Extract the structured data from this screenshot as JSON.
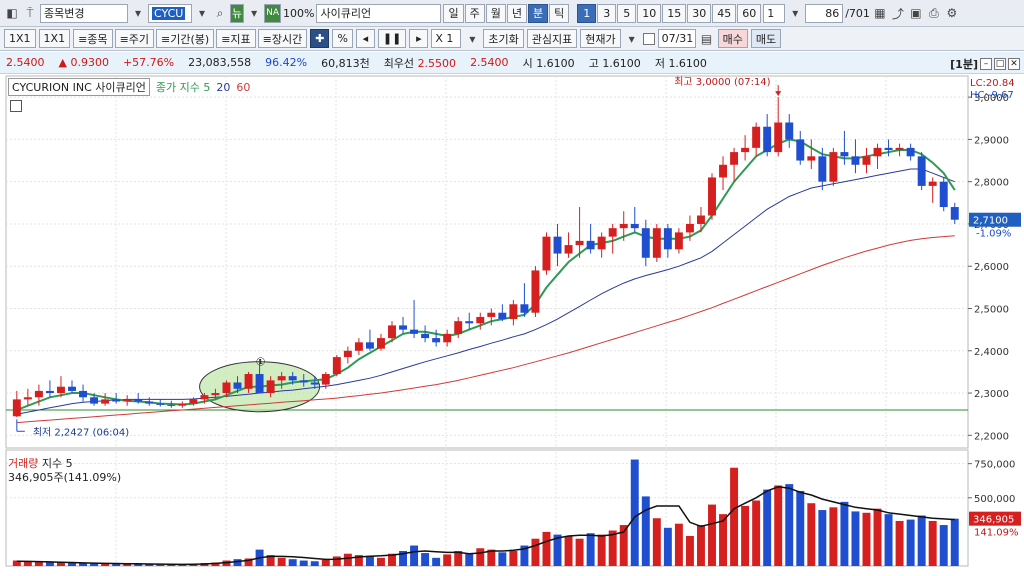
{
  "toolbar": {
    "change_stock": "종목변경",
    "code": "CYCU",
    "new_badge": "뉴",
    "na_badge": "NA",
    "zoom": "100%",
    "stock_name": "사이큐리언",
    "periods": [
      "일",
      "주",
      "월",
      "년",
      "분",
      "틱"
    ],
    "active_period": "분",
    "intervals": [
      "1",
      "3",
      "5",
      "10",
      "15",
      "30",
      "45",
      "60"
    ],
    "interval_value": "1",
    "count": "86",
    "total": "/701"
  },
  "toolbar2": {
    "layout1": "1X1",
    "layout2": "1X1",
    "items": [
      "≡종목",
      "≡주기",
      "≡기간(봉)",
      "≡지표",
      "≡장시간"
    ],
    "multiplier": "X 1",
    "reset": "초기화",
    "indicators": "관심지표",
    "price_type": "현재가",
    "date": "07/31",
    "buy": "매수",
    "sell": "매도"
  },
  "quote": {
    "price": "2.5400",
    "change": "0.9300",
    "change_pct": "+57.76%",
    "volume": "23,083,558",
    "vol_ratio": "96.42%",
    "amount": "60,813천",
    "best_ask_label": "최우선",
    "best_ask": "2.5500",
    "best_bid": "2.5400",
    "open_label": "시",
    "open": "1.6100",
    "high_label": "고",
    "high": "1.6100",
    "low_label": "저",
    "low": "1.6100",
    "frame": "[1분]"
  },
  "legend": {
    "name": "CYCURION INC",
    "name_kr": "사이큐리언",
    "ma_label": "종가 지수 5",
    "ma20": "20",
    "ma60": "60"
  },
  "colors": {
    "up": "#d62020",
    "down": "#1f4fd0",
    "ma5": "#2e9a52",
    "ma20": "#2a3a9a",
    "ma60": "#d03a3a",
    "vol_ma": "#111111",
    "ref_line": "#2e8b2e",
    "price_tag": "#1f5fbf"
  },
  "chart_data": {
    "type": "candlestick",
    "y_ticks": [
      "3,0000",
      "2,9000",
      "2,8000",
      "2,7000",
      "2,6000",
      "2,5000",
      "2,4000",
      "2,3000",
      "2,2000"
    ],
    "ylim": [
      2.17,
      3.05
    ],
    "lc_label": "LC:20.84",
    "hc_label": "HC:-9.67",
    "current_price_label": "2,7100",
    "current_change_label": "-1.09%",
    "high_annotation": "최고 3,0000 (07:14)",
    "low_annotation": "최저 2,2427 (06:04)",
    "circle_marker": "①",
    "candles": [
      {
        "o": 2.245,
        "h": 2.305,
        "l": 2.243,
        "c": 2.285
      },
      {
        "o": 2.285,
        "h": 2.31,
        "l": 2.27,
        "c": 2.29
      },
      {
        "o": 2.29,
        "h": 2.32,
        "l": 2.27,
        "c": 2.305
      },
      {
        "o": 2.305,
        "h": 2.33,
        "l": 2.29,
        "c": 2.3
      },
      {
        "o": 2.3,
        "h": 2.34,
        "l": 2.29,
        "c": 2.315
      },
      {
        "o": 2.315,
        "h": 2.33,
        "l": 2.3,
        "c": 2.305
      },
      {
        "o": 2.305,
        "h": 2.32,
        "l": 2.28,
        "c": 2.29
      },
      {
        "o": 2.29,
        "h": 2.3,
        "l": 2.27,
        "c": 2.275
      },
      {
        "o": 2.275,
        "h": 2.3,
        "l": 2.27,
        "c": 2.285
      },
      {
        "o": 2.285,
        "h": 2.3,
        "l": 2.275,
        "c": 2.28
      },
      {
        "o": 2.28,
        "h": 2.295,
        "l": 2.27,
        "c": 2.285
      },
      {
        "o": 2.285,
        "h": 2.3,
        "l": 2.275,
        "c": 2.28
      },
      {
        "o": 2.28,
        "h": 2.29,
        "l": 2.27,
        "c": 2.275
      },
      {
        "o": 2.275,
        "h": 2.285,
        "l": 2.268,
        "c": 2.272
      },
      {
        "o": 2.272,
        "h": 2.282,
        "l": 2.265,
        "c": 2.27
      },
      {
        "o": 2.27,
        "h": 2.28,
        "l": 2.265,
        "c": 2.275
      },
      {
        "o": 2.275,
        "h": 2.29,
        "l": 2.27,
        "c": 2.285
      },
      {
        "o": 2.285,
        "h": 2.3,
        "l": 2.275,
        "c": 2.295
      },
      {
        "o": 2.295,
        "h": 2.31,
        "l": 2.285,
        "c": 2.3
      },
      {
        "o": 2.3,
        "h": 2.33,
        "l": 2.29,
        "c": 2.325
      },
      {
        "o": 2.325,
        "h": 2.34,
        "l": 2.3,
        "c": 2.31
      },
      {
        "o": 2.31,
        "h": 2.35,
        "l": 2.3,
        "c": 2.345
      },
      {
        "o": 2.345,
        "h": 2.38,
        "l": 2.3,
        "c": 2.3
      },
      {
        "o": 2.3,
        "h": 2.34,
        "l": 2.29,
        "c": 2.33
      },
      {
        "o": 2.33,
        "h": 2.35,
        "l": 2.31,
        "c": 2.34
      },
      {
        "o": 2.34,
        "h": 2.35,
        "l": 2.32,
        "c": 2.33
      },
      {
        "o": 2.33,
        "h": 2.345,
        "l": 2.315,
        "c": 2.325
      },
      {
        "o": 2.325,
        "h": 2.34,
        "l": 2.31,
        "c": 2.32
      },
      {
        "o": 2.32,
        "h": 2.35,
        "l": 2.31,
        "c": 2.345
      },
      {
        "o": 2.345,
        "h": 2.39,
        "l": 2.34,
        "c": 2.385
      },
      {
        "o": 2.385,
        "h": 2.41,
        "l": 2.37,
        "c": 2.4
      },
      {
        "o": 2.4,
        "h": 2.43,
        "l": 2.39,
        "c": 2.42
      },
      {
        "o": 2.42,
        "h": 2.45,
        "l": 2.4,
        "c": 2.405
      },
      {
        "o": 2.405,
        "h": 2.44,
        "l": 2.4,
        "c": 2.43
      },
      {
        "o": 2.43,
        "h": 2.47,
        "l": 2.42,
        "c": 2.46
      },
      {
        "o": 2.46,
        "h": 2.48,
        "l": 2.44,
        "c": 2.45
      },
      {
        "o": 2.45,
        "h": 2.52,
        "l": 2.43,
        "c": 2.44
      },
      {
        "o": 2.44,
        "h": 2.46,
        "l": 2.42,
        "c": 2.43
      },
      {
        "o": 2.43,
        "h": 2.45,
        "l": 2.41,
        "c": 2.42
      },
      {
        "o": 2.42,
        "h": 2.45,
        "l": 2.41,
        "c": 2.44
      },
      {
        "o": 2.44,
        "h": 2.48,
        "l": 2.43,
        "c": 2.47
      },
      {
        "o": 2.47,
        "h": 2.49,
        "l": 2.45,
        "c": 2.465
      },
      {
        "o": 2.465,
        "h": 2.49,
        "l": 2.45,
        "c": 2.48
      },
      {
        "o": 2.48,
        "h": 2.5,
        "l": 2.46,
        "c": 2.49
      },
      {
        "o": 2.49,
        "h": 2.51,
        "l": 2.47,
        "c": 2.475
      },
      {
        "o": 2.475,
        "h": 2.52,
        "l": 2.46,
        "c": 2.51
      },
      {
        "o": 2.51,
        "h": 2.56,
        "l": 2.48,
        "c": 2.49
      },
      {
        "o": 2.49,
        "h": 2.6,
        "l": 2.48,
        "c": 2.59
      },
      {
        "o": 2.59,
        "h": 2.68,
        "l": 2.58,
        "c": 2.67
      },
      {
        "o": 2.67,
        "h": 2.7,
        "l": 2.6,
        "c": 2.63
      },
      {
        "o": 2.63,
        "h": 2.68,
        "l": 2.62,
        "c": 2.65
      },
      {
        "o": 2.65,
        "h": 2.74,
        "l": 2.62,
        "c": 2.66
      },
      {
        "o": 2.66,
        "h": 2.7,
        "l": 2.63,
        "c": 2.64
      },
      {
        "o": 2.64,
        "h": 2.68,
        "l": 2.62,
        "c": 2.67
      },
      {
        "o": 2.67,
        "h": 2.7,
        "l": 2.63,
        "c": 2.69
      },
      {
        "o": 2.69,
        "h": 2.73,
        "l": 2.66,
        "c": 2.7
      },
      {
        "o": 2.7,
        "h": 2.74,
        "l": 2.68,
        "c": 2.69
      },
      {
        "o": 2.69,
        "h": 2.71,
        "l": 2.6,
        "c": 2.62
      },
      {
        "o": 2.62,
        "h": 2.7,
        "l": 2.61,
        "c": 2.69
      },
      {
        "o": 2.69,
        "h": 2.7,
        "l": 2.62,
        "c": 2.64
      },
      {
        "o": 2.64,
        "h": 2.69,
        "l": 2.63,
        "c": 2.68
      },
      {
        "o": 2.68,
        "h": 2.72,
        "l": 2.66,
        "c": 2.7
      },
      {
        "o": 2.7,
        "h": 2.74,
        "l": 2.68,
        "c": 2.72
      },
      {
        "o": 2.72,
        "h": 2.82,
        "l": 2.71,
        "c": 2.81
      },
      {
        "o": 2.81,
        "h": 2.86,
        "l": 2.78,
        "c": 2.84
      },
      {
        "o": 2.84,
        "h": 2.88,
        "l": 2.8,
        "c": 2.87
      },
      {
        "o": 2.87,
        "h": 2.91,
        "l": 2.85,
        "c": 2.88
      },
      {
        "o": 2.88,
        "h": 2.94,
        "l": 2.86,
        "c": 2.93
      },
      {
        "o": 2.93,
        "h": 2.96,
        "l": 2.86,
        "c": 2.87
      },
      {
        "o": 2.87,
        "h": 3.0,
        "l": 2.86,
        "c": 2.94
      },
      {
        "o": 2.94,
        "h": 2.96,
        "l": 2.88,
        "c": 2.9
      },
      {
        "o": 2.9,
        "h": 2.92,
        "l": 2.84,
        "c": 2.85
      },
      {
        "o": 2.85,
        "h": 2.9,
        "l": 2.83,
        "c": 2.86
      },
      {
        "o": 2.86,
        "h": 2.88,
        "l": 2.78,
        "c": 2.8
      },
      {
        "o": 2.8,
        "h": 2.88,
        "l": 2.79,
        "c": 2.87
      },
      {
        "o": 2.87,
        "h": 2.92,
        "l": 2.84,
        "c": 2.86
      },
      {
        "o": 2.86,
        "h": 2.9,
        "l": 2.82,
        "c": 2.84
      },
      {
        "o": 2.84,
        "h": 2.88,
        "l": 2.82,
        "c": 2.86
      },
      {
        "o": 2.86,
        "h": 2.89,
        "l": 2.83,
        "c": 2.88
      },
      {
        "o": 2.88,
        "h": 2.9,
        "l": 2.86,
        "c": 2.875
      },
      {
        "o": 2.875,
        "h": 2.89,
        "l": 2.86,
        "c": 2.88
      },
      {
        "o": 2.88,
        "h": 2.89,
        "l": 2.85,
        "c": 2.86
      },
      {
        "o": 2.86,
        "h": 2.87,
        "l": 2.78,
        "c": 2.79
      },
      {
        "o": 2.79,
        "h": 2.81,
        "l": 2.75,
        "c": 2.8
      },
      {
        "o": 2.8,
        "h": 2.81,
        "l": 2.73,
        "c": 2.74
      },
      {
        "o": 2.74,
        "h": 2.75,
        "l": 2.7,
        "c": 2.71
      }
    ],
    "ma5": [
      2.26,
      2.27,
      2.28,
      2.29,
      2.295,
      2.3,
      2.3,
      2.295,
      2.29,
      2.285,
      2.282,
      2.28,
      2.278,
      2.275,
      2.274,
      2.273,
      2.275,
      2.28,
      2.285,
      2.295,
      2.305,
      2.315,
      2.315,
      2.318,
      2.32,
      2.325,
      2.328,
      2.33,
      2.333,
      2.345,
      2.36,
      2.38,
      2.395,
      2.41,
      2.425,
      2.44,
      2.445,
      2.445,
      2.44,
      2.435,
      2.44,
      2.45,
      2.46,
      2.47,
      2.475,
      2.48,
      2.485,
      2.51,
      2.55,
      2.58,
      2.61,
      2.63,
      2.65,
      2.655,
      2.66,
      2.67,
      2.68,
      2.67,
      2.665,
      2.665,
      2.665,
      2.67,
      2.685,
      2.72,
      2.76,
      2.8,
      2.83,
      2.86,
      2.875,
      2.89,
      2.9,
      2.895,
      2.88,
      2.865,
      2.86,
      2.855,
      2.855,
      2.86,
      2.865,
      2.87,
      2.875,
      2.875,
      2.865,
      2.845,
      2.82,
      2.78
    ],
    "ma20": [
      2.25,
      2.255,
      2.26,
      2.265,
      2.27,
      2.275,
      2.278,
      2.28,
      2.282,
      2.284,
      2.285,
      2.285,
      2.285,
      2.285,
      2.285,
      2.285,
      2.286,
      2.288,
      2.29,
      2.292,
      2.295,
      2.297,
      2.3,
      2.302,
      2.305,
      2.307,
      2.31,
      2.313,
      2.316,
      2.32,
      2.325,
      2.33,
      2.335,
      2.342,
      2.35,
      2.358,
      2.366,
      2.374,
      2.381,
      2.388,
      2.395,
      2.403,
      2.41,
      2.418,
      2.425,
      2.433,
      2.44,
      2.45,
      2.462,
      2.475,
      2.49,
      2.505,
      2.52,
      2.535,
      2.548,
      2.56,
      2.57,
      2.578,
      2.585,
      2.592,
      2.6,
      2.61,
      2.62,
      2.635,
      2.655,
      2.675,
      2.695,
      2.715,
      2.735,
      2.75,
      2.765,
      2.775,
      2.785,
      2.79,
      2.795,
      2.8,
      2.805,
      2.81,
      2.815,
      2.82,
      2.825,
      2.83,
      2.83,
      2.82,
      2.81,
      2.8
    ],
    "ma60": [
      2.23,
      2.232,
      2.234,
      2.236,
      2.238,
      2.24,
      2.242,
      2.244,
      2.246,
      2.248,
      2.25,
      2.252,
      2.254,
      2.256,
      2.258,
      2.26,
      2.262,
      2.264,
      2.266,
      2.268,
      2.27,
      2.272,
      2.274,
      2.276,
      2.278,
      2.28,
      2.282,
      2.284,
      2.286,
      2.288,
      2.291,
      2.294,
      2.297,
      2.3,
      2.304,
      2.308,
      2.312,
      2.316,
      2.32,
      2.325,
      2.33,
      2.336,
      2.342,
      2.348,
      2.354,
      2.36,
      2.367,
      2.374,
      2.381,
      2.388,
      2.395,
      2.403,
      2.411,
      2.419,
      2.427,
      2.435,
      2.443,
      2.451,
      2.459,
      2.467,
      2.475,
      2.484,
      2.493,
      2.502,
      2.512,
      2.522,
      2.532,
      2.542,
      2.552,
      2.562,
      2.572,
      2.582,
      2.592,
      2.602,
      2.611,
      2.62,
      2.628,
      2.636,
      2.643,
      2.65,
      2.656,
      2.661,
      2.665,
      2.668,
      2.67,
      2.672
    ],
    "ref_line_value": 2.26,
    "volume": {
      "label": "거래량",
      "ma_label": "지수 5",
      "value_label": "346,905주(141.09%)",
      "y_ticks": [
        "750,000",
        "500,000"
      ],
      "ylim": [
        0,
        850000
      ],
      "current_label": "346,905",
      "current_pct": "141.09%",
      "values": [
        40000,
        35000,
        30000,
        28000,
        25000,
        22000,
        20000,
        18000,
        15000,
        18000,
        20000,
        15000,
        12000,
        10000,
        9000,
        12000,
        15000,
        22000,
        25000,
        40000,
        50000,
        55000,
        120000,
        80000,
        60000,
        50000,
        40000,
        35000,
        45000,
        70000,
        90000,
        80000,
        75000,
        60000,
        90000,
        110000,
        150000,
        95000,
        60000,
        85000,
        110000,
        90000,
        130000,
        120000,
        100000,
        110000,
        150000,
        200000,
        250000,
        230000,
        220000,
        200000,
        240000,
        230000,
        260000,
        300000,
        780000,
        510000,
        350000,
        280000,
        310000,
        220000,
        300000,
        450000,
        380000,
        720000,
        440000,
        480000,
        560000,
        590000,
        600000,
        550000,
        460000,
        410000,
        430000,
        470000,
        400000,
        390000,
        420000,
        380000,
        330000,
        340000,
        370000,
        330000,
        300000,
        346905
      ],
      "ma5": [
        35000,
        34000,
        32000,
        30000,
        28000,
        26000,
        23000,
        21000,
        19000,
        18000,
        17000,
        16000,
        15000,
        14000,
        13000,
        12000,
        13000,
        15000,
        19000,
        25000,
        33000,
        41000,
        60000,
        70000,
        70000,
        68000,
        62000,
        55000,
        48000,
        50000,
        58000,
        66000,
        72000,
        75000,
        80000,
        90000,
        105000,
        110000,
        105000,
        100000,
        100000,
        90000,
        95000,
        110000,
        110000,
        115000,
        125000,
        150000,
        180000,
        205000,
        220000,
        225000,
        225000,
        220000,
        230000,
        250000,
        360000,
        410000,
        440000,
        440000,
        440000,
        320000,
        290000,
        310000,
        330000,
        420000,
        460000,
        500000,
        550000,
        580000,
        570000,
        540000,
        520000,
        490000,
        470000,
        450000,
        430000,
        420000,
        410000,
        390000,
        380000,
        370000,
        360000,
        350000,
        345000,
        340000
      ]
    }
  }
}
